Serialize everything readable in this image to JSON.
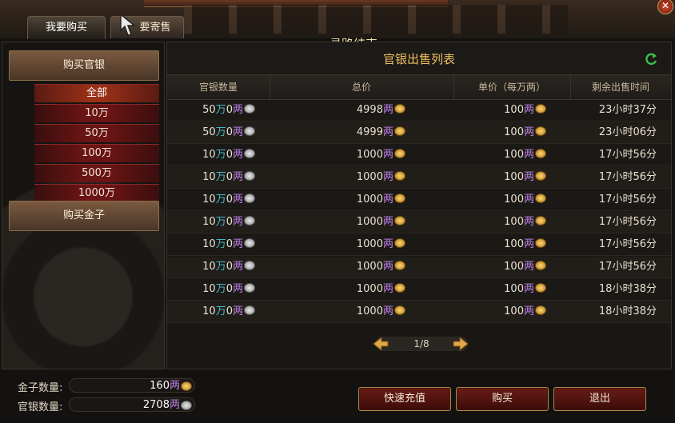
{
  "tabs": [
    {
      "label": "我要购买",
      "active": true
    },
    {
      "label": "要寄售",
      "active": false
    }
  ],
  "map_status": "寻路结束",
  "left_panel": {
    "buy_silver_label": "购买官银",
    "filters": [
      "全部",
      "10万",
      "50万",
      "100万",
      "500万",
      "1000万"
    ],
    "selected_filter": "全部",
    "buy_gold_label": "购买金子"
  },
  "list": {
    "title": "官银出售列表",
    "headers": [
      "官银数量",
      "总价",
      "单价（每万两）",
      "剩余出售时间"
    ],
    "units": {
      "wan": "万",
      "liang": "两"
    },
    "rows": [
      {
        "qty_wan": "50",
        "qty_liang": "0",
        "total": "4998",
        "unit_price": "100",
        "time_left": "23小时37分"
      },
      {
        "qty_wan": "50",
        "qty_liang": "0",
        "total": "4999",
        "unit_price": "100",
        "time_left": "23小时06分"
      },
      {
        "qty_wan": "10",
        "qty_liang": "0",
        "total": "1000",
        "unit_price": "100",
        "time_left": "17小时56分"
      },
      {
        "qty_wan": "10",
        "qty_liang": "0",
        "total": "1000",
        "unit_price": "100",
        "time_left": "17小时56分"
      },
      {
        "qty_wan": "10",
        "qty_liang": "0",
        "total": "1000",
        "unit_price": "100",
        "time_left": "17小时56分"
      },
      {
        "qty_wan": "10",
        "qty_liang": "0",
        "total": "1000",
        "unit_price": "100",
        "time_left": "17小时56分"
      },
      {
        "qty_wan": "10",
        "qty_liang": "0",
        "total": "1000",
        "unit_price": "100",
        "time_left": "17小时56分"
      },
      {
        "qty_wan": "10",
        "qty_liang": "0",
        "total": "1000",
        "unit_price": "100",
        "time_left": "17小时56分"
      },
      {
        "qty_wan": "10",
        "qty_liang": "0",
        "total": "1000",
        "unit_price": "100",
        "time_left": "18小时38分"
      },
      {
        "qty_wan": "10",
        "qty_liang": "0",
        "total": "1000",
        "unit_price": "100",
        "time_left": "18小时38分"
      }
    ],
    "pager": "1/8"
  },
  "stats": {
    "gold_label": "金子数量:",
    "gold_value": "160",
    "silver_label": "官银数量:",
    "silver_value": "2708",
    "unit": "两"
  },
  "buttons": {
    "recharge": "快速充值",
    "buy": "购买",
    "exit": "退出"
  },
  "icons": {
    "close": "close-icon",
    "refresh": "refresh-icon",
    "silver": "silver-coin-icon",
    "gold": "gold-coin-icon",
    "prev": "arrow-left-icon",
    "next": "arrow-right-icon"
  },
  "colors": {
    "title": "#f0c060",
    "wan_unit": "#44b7c8",
    "liang_unit": "#c080e8",
    "button_red": "#6a1c14"
  }
}
